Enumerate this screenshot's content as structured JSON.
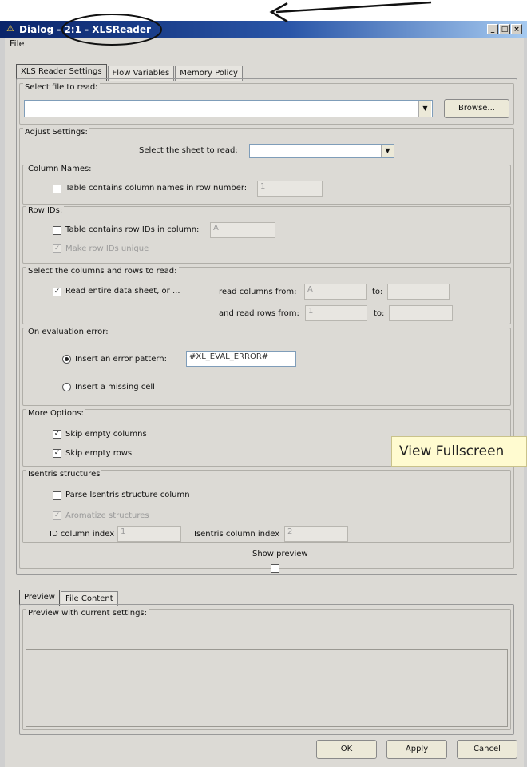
{
  "window": {
    "title": "Dialog - 2:1 - XLSReader",
    "menu": [
      "File"
    ]
  },
  "top_tabs": [
    "XLS Reader Settings",
    "Flow Variables",
    "Memory Policy"
  ],
  "select_file": {
    "group_title": "Select file to read:",
    "path_value": "",
    "browse_label": "Browse..."
  },
  "adjust": {
    "group_title": "Adjust Settings:",
    "sheet_label": "Select the sheet to read:",
    "sheet_value": ""
  },
  "column_names": {
    "group_title": "Column Names:",
    "checkbox_label": "Table contains column names in row number:",
    "checked": false,
    "row_value": "1"
  },
  "row_ids": {
    "group_title": "Row IDs:",
    "checkbox_label": "Table contains row IDs in column:",
    "checked": false,
    "column_value": "A",
    "unique_label": "Make row IDs unique",
    "unique_checked": true
  },
  "columns_rows": {
    "group_title": "Select the columns and rows to read:",
    "entire_label": "Read entire data sheet, or ...",
    "entire_checked": true,
    "cols_from_label": "read columns from:",
    "cols_from_value": "A",
    "cols_to_label": "to:",
    "cols_to_value": "",
    "rows_from_label": "and read rows from:",
    "rows_from_value": "1",
    "rows_to_label": "to:",
    "rows_to_value": ""
  },
  "eval_error": {
    "group_title": "On evaluation error:",
    "pattern_label": "Insert an error pattern:",
    "pattern_value": "#XL_EVAL_ERROR#",
    "missing_label": "Insert a missing cell",
    "selected": "pattern"
  },
  "more_options": {
    "group_title": "More Options:",
    "skip_cols_label": "Skip empty columns",
    "skip_cols_checked": true,
    "skip_rows_label": "Skip empty rows",
    "skip_rows_checked": true
  },
  "isentris": {
    "group_title": "Isentris structures",
    "parse_label": "Parse Isentris structure column",
    "parse_checked": false,
    "aromatize_label": "Aromatize structures",
    "aromatize_checked": true,
    "id_index_label": "ID column index",
    "id_index_value": "1",
    "isentris_index_label": "Isentris column index",
    "isentris_index_value": "2"
  },
  "preview_toggle": {
    "label": "Show preview",
    "checked": false
  },
  "bottom_tabs": [
    "Preview",
    "File Content"
  ],
  "preview": {
    "group_title": "Preview with current settings:"
  },
  "tooltip": "View Fullscreen",
  "buttons": {
    "ok": "OK",
    "apply": "Apply",
    "cancel": "Cancel"
  },
  "colors": {
    "titlebar_start": "#0a246a",
    "titlebar_end": "#a6caf0",
    "annotation": "#000000"
  }
}
